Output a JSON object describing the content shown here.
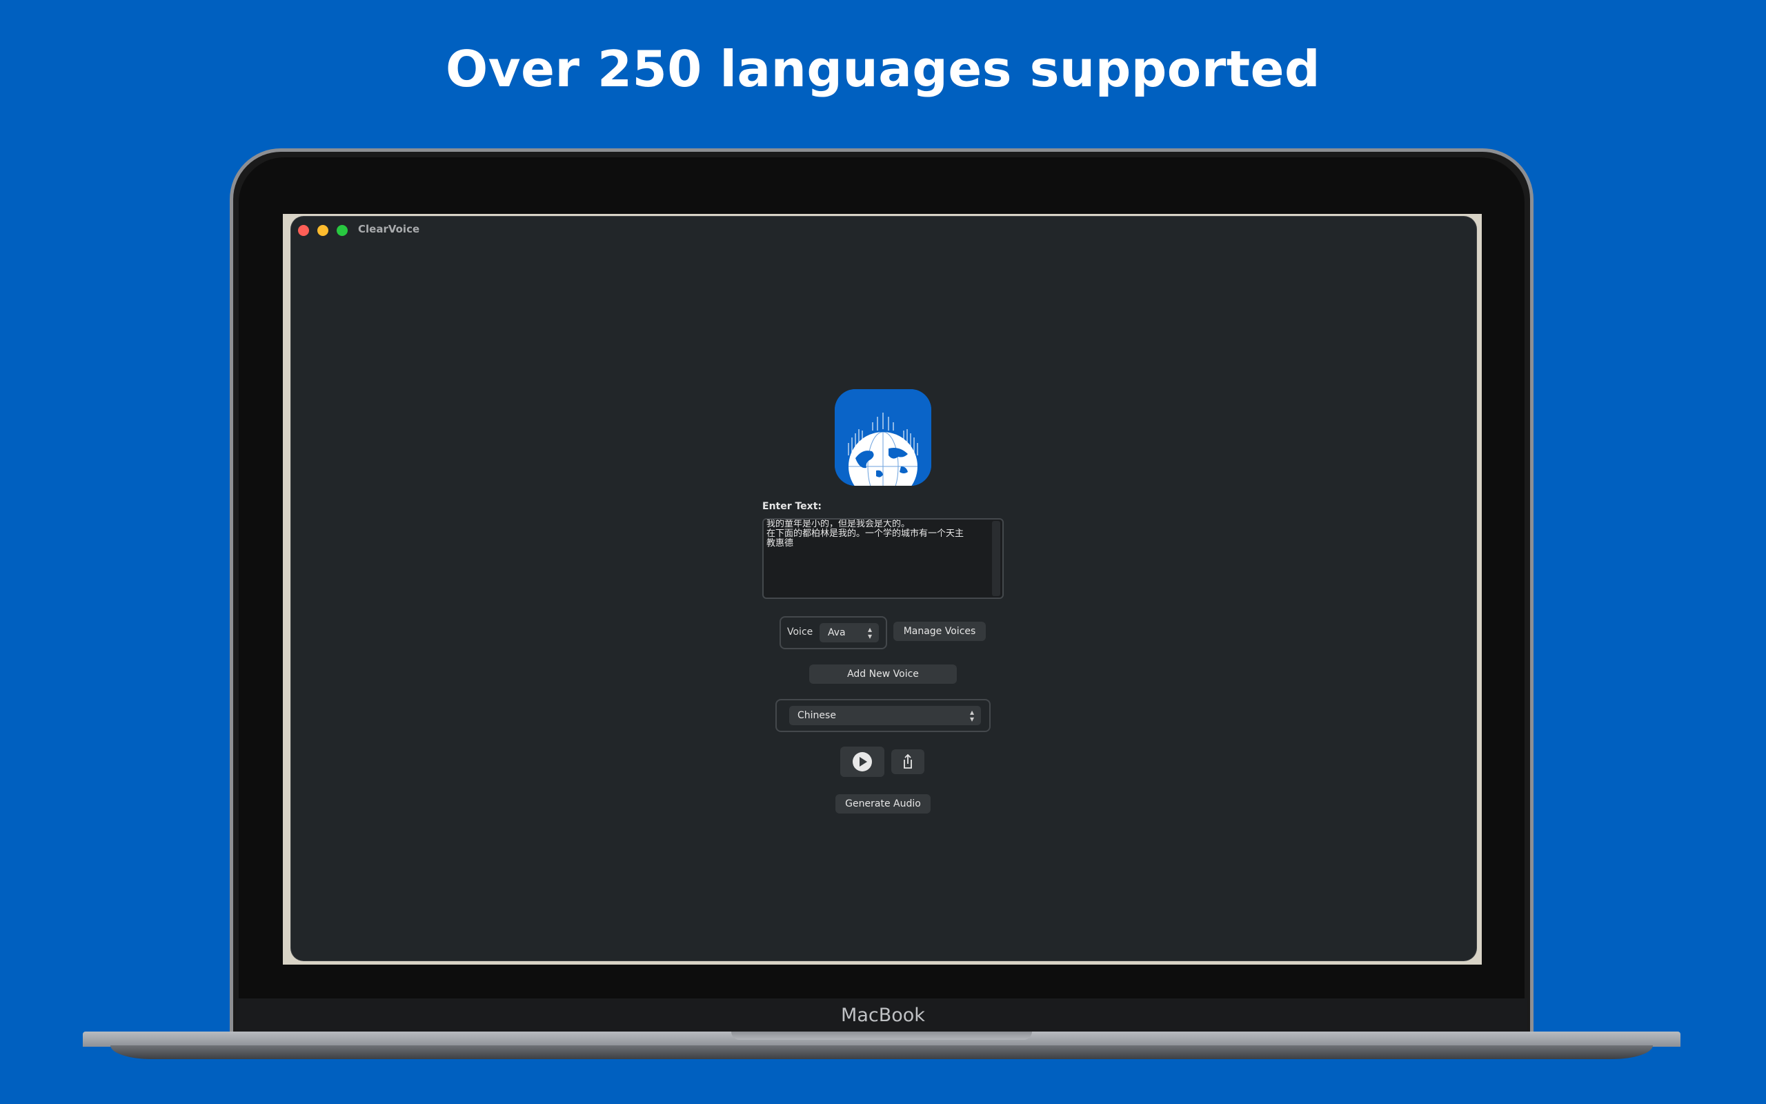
{
  "headline": "Over 250 languages supported",
  "device_label": "MacBook",
  "window": {
    "title": "ClearVoice"
  },
  "form": {
    "text_label": "Enter Text:",
    "text_value": "我的童年是小的，但是我会是大的。\n在下面的都柏林是我的。一个学的城市有一个天主\n教惠德",
    "voice_label": "Voice",
    "voice_selected": "Ava",
    "manage_voices_label": "Manage Voices",
    "add_voice_label": "Add New Voice",
    "language_selected": "Chinese",
    "generate_label": "Generate Audio"
  },
  "icons": {
    "app": "globe-soundwave-icon",
    "play": "play-icon",
    "share": "share-icon",
    "chevron": "chevron-updown-icon"
  },
  "colors": {
    "background": "#0060C0",
    "window": "#222629",
    "control": "#35393c",
    "close": "#ff5f57",
    "minimize": "#febc2e",
    "maximize": "#28c840"
  }
}
